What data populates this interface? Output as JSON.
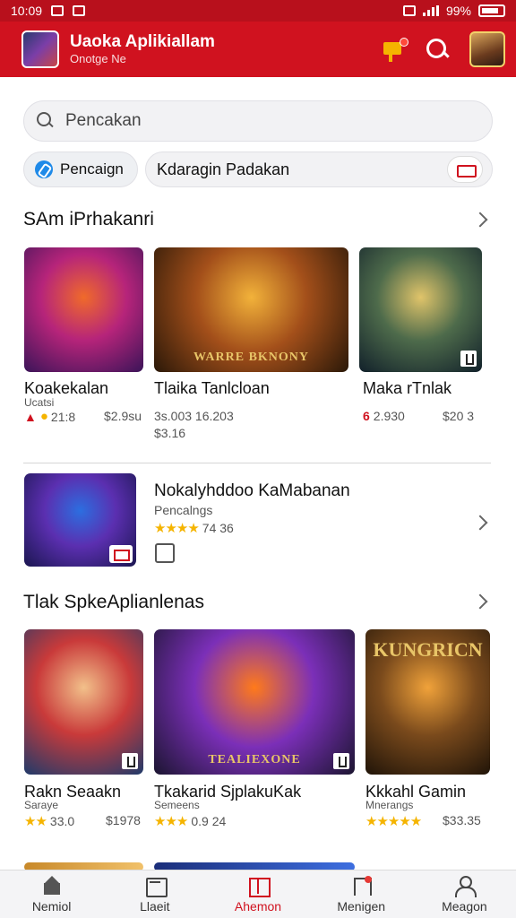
{
  "status_bar": {
    "time": "10:09",
    "battery": "99%"
  },
  "app_bar": {
    "title": "Uaoka Aplikiallam",
    "subtitle": "Onotge Ne"
  },
  "search": {
    "placeholder": "Pencakan"
  },
  "chips": {
    "primary": "Pencaign",
    "secondary": "Kdaragin Padakan"
  },
  "section1": {
    "title": "SAm iPrhakanri",
    "items": [
      {
        "title": "Koakekalan",
        "sub": "Ucatsi",
        "rating": "21:8",
        "price": "$2.9su",
        "colors": [
          "#3a1458",
          "#b6247a",
          "#f06a2a"
        ]
      },
      {
        "title": "Tlaika Tanlcloan",
        "sub": "",
        "rating": "3s.003 16.203",
        "price": "$3.16",
        "art_text": "WARRE BKNONY",
        "colors": [
          "#2a1808",
          "#a34f1a",
          "#f2b23a"
        ]
      },
      {
        "title": "Maka rTnlak",
        "sub": "",
        "rating": "2.930",
        "price": "$20 3",
        "colors": [
          "#11202a",
          "#4e6b4b",
          "#e0c46a"
        ]
      }
    ]
  },
  "featured": {
    "title": "Nokalyhddoo KaMabanan",
    "sub": "Pencalngs",
    "rating": "74 36",
    "colors": [
      "#1a1650",
      "#5b2fb0",
      "#2c6ee0"
    ]
  },
  "section2": {
    "title": "Tlak SpkeAplianlenas",
    "items": [
      {
        "title": "Rakn Seaakn",
        "sub": "Saraye",
        "rating": "33.0",
        "price": "$1978",
        "colors": [
          "#1f3a6a",
          "#c93a3a",
          "#f2c08a"
        ]
      },
      {
        "title": "Tkakarid SjplakuKak",
        "sub": "Semeens",
        "rating": "0.9 24",
        "price": "",
        "art_text": "TEALIEXONE",
        "colors": [
          "#1b1530",
          "#7b2fb8",
          "#ff7a1a"
        ]
      },
      {
        "title": "Kkkahl Gamin",
        "sub": "Mnerangs",
        "rating": "",
        "price": "$33.35",
        "art_top": "KUNGRICN",
        "colors": [
          "#201408",
          "#7a4a1c",
          "#f0a23a"
        ]
      }
    ]
  },
  "bottom_nav": [
    {
      "label": "Nemiol"
    },
    {
      "label": "Llaeit"
    },
    {
      "label": "Ahemon"
    },
    {
      "label": "Menigen"
    },
    {
      "label": "Meagon"
    }
  ]
}
